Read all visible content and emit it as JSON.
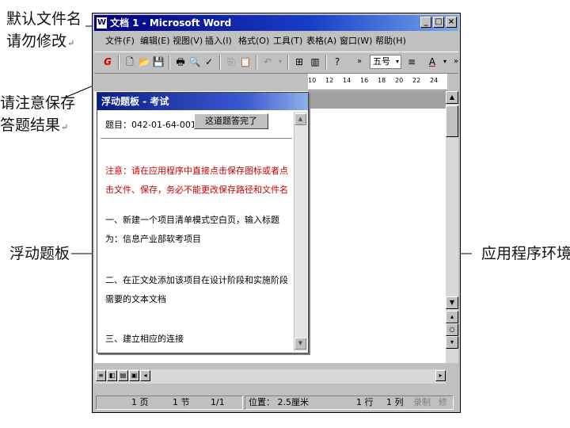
{
  "annotations": {
    "default_name_line1": "默认文件名",
    "default_name_line2": "请勿修改",
    "save_line1": "请注意保存",
    "save_line2": "答题结果",
    "panel_label": "浮动题板",
    "app_env_label": "应用程序环境"
  },
  "window": {
    "title": "文档 1 - Microsoft Word",
    "icon_label": "W"
  },
  "menu": [
    "文件(F)",
    "编辑(E)",
    "视图(V)",
    "插入(I)",
    "格式(O)",
    "工具(T)",
    "表格(A)",
    "窗口(W)",
    "帮助(H)"
  ],
  "toolbar": {
    "font_size": "五号"
  },
  "ruler": [
    "10",
    "12",
    "14",
    "16",
    "18",
    "20",
    "22",
    "24"
  ],
  "panel": {
    "title": "浮动题板 - 考试",
    "question_id": "题目：042-01-64-001",
    "done_button": "这道题答完了",
    "note_line1": "注意：请在应用程序中直接点击保存图标或者点",
    "note_line2": "击文件、保存，务必不能更改保存路径和文件名",
    "task1_line1": "一、新建一个项目清单模式空白页，输入标题",
    "task1_line2": "为：信息产业部软考项目",
    "task2_line1": "二、在正文处添加该项目在设计阶段和实施阶段",
    "task2_line2": "需要的文本文档",
    "task3_line1": "三、建立相应的连接"
  },
  "status": {
    "page": "1 页",
    "section": "1 节",
    "page_ratio": "1/1",
    "position": "位置： 2.5厘米",
    "line": "1 行",
    "col": "1 列",
    "rec": "录制",
    "rev": "修"
  },
  "colors": {
    "note_text": "#d00000",
    "title_bar": "#00007c"
  }
}
